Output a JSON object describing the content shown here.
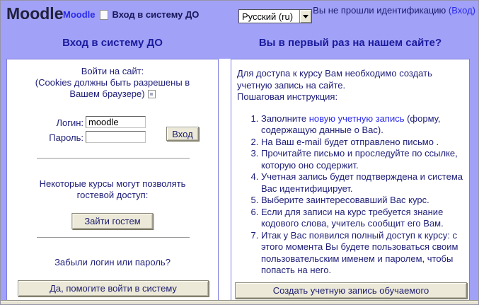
{
  "colors": {
    "page_bg": "#a1a1f7",
    "panel_bg": "#ffffff",
    "panel_border": "#7d7de0",
    "text": "#20207a",
    "heading": "#1b1b9e",
    "link": "#2a2aee",
    "button_bg": "#ece9d8",
    "strip_bg": "#e5e2d2"
  },
  "header": {
    "logo": "Moodle",
    "breadcrumb": {
      "home": "Moodle",
      "current": "Вход в систему ДО"
    },
    "language": {
      "selected": "Русский (ru)"
    },
    "auth_status": {
      "text": "Вы не прошли идентификацию ",
      "link": "(Вход)"
    }
  },
  "login": {
    "heading": "Вход в систему ДО",
    "intro_line1": "Войти на сайт:",
    "intro_line2": "(Cookies должны быть разрешены в",
    "intro_line3": "Вашем браузере)",
    "username_label": "Логин:",
    "username_value": "moodle",
    "password_label": "Пароль:",
    "password_value": "",
    "submit_label": "Вход",
    "guest_line1": "Некоторые курсы могут позволять",
    "guest_line2": "гостевой доступ:",
    "guest_button": "Зайти гостем",
    "forgot_question": "Забыли логин или пароль?",
    "forgot_button": "Да, помогите войти в систему"
  },
  "signup": {
    "heading": "Вы в первый раз на нашем сайте?",
    "intro_text": "Для доступа к курсу Вам необходимо создать учетную запись на сайте.",
    "intro_text2": "Пошаговая инструкция:",
    "steps": [
      {
        "pre": "Заполните ",
        "link": "новую учетную запись",
        "post": " (форму, содержащую данные о Вас)."
      },
      {
        "pre": "На Ваш e-mail будет отправлено письмо .",
        "link": "",
        "post": ""
      },
      {
        "pre": "Прочитайте письмо и проследуйте по ссылке, которую оно содержит.",
        "link": "",
        "post": ""
      },
      {
        "pre": "Учетная запись будет подтверждена и система Вас идентифицирует.",
        "link": "",
        "post": ""
      },
      {
        "pre": "Выберите заинтересовавший Вас курс.",
        "link": "",
        "post": ""
      },
      {
        "pre": "Если для записи на курс требуется знание кодового слова, учитель сообщит его Вам.",
        "link": "",
        "post": ""
      },
      {
        "pre": "Итак у Вас появился полный доступ к курсу: с этого момента Вы будете пользоваться своим пользовательским именем и паролем, чтобы попасть на него.",
        "link": "",
        "post": ""
      }
    ],
    "signup_button": "Создать учетную запись обучаемого"
  }
}
